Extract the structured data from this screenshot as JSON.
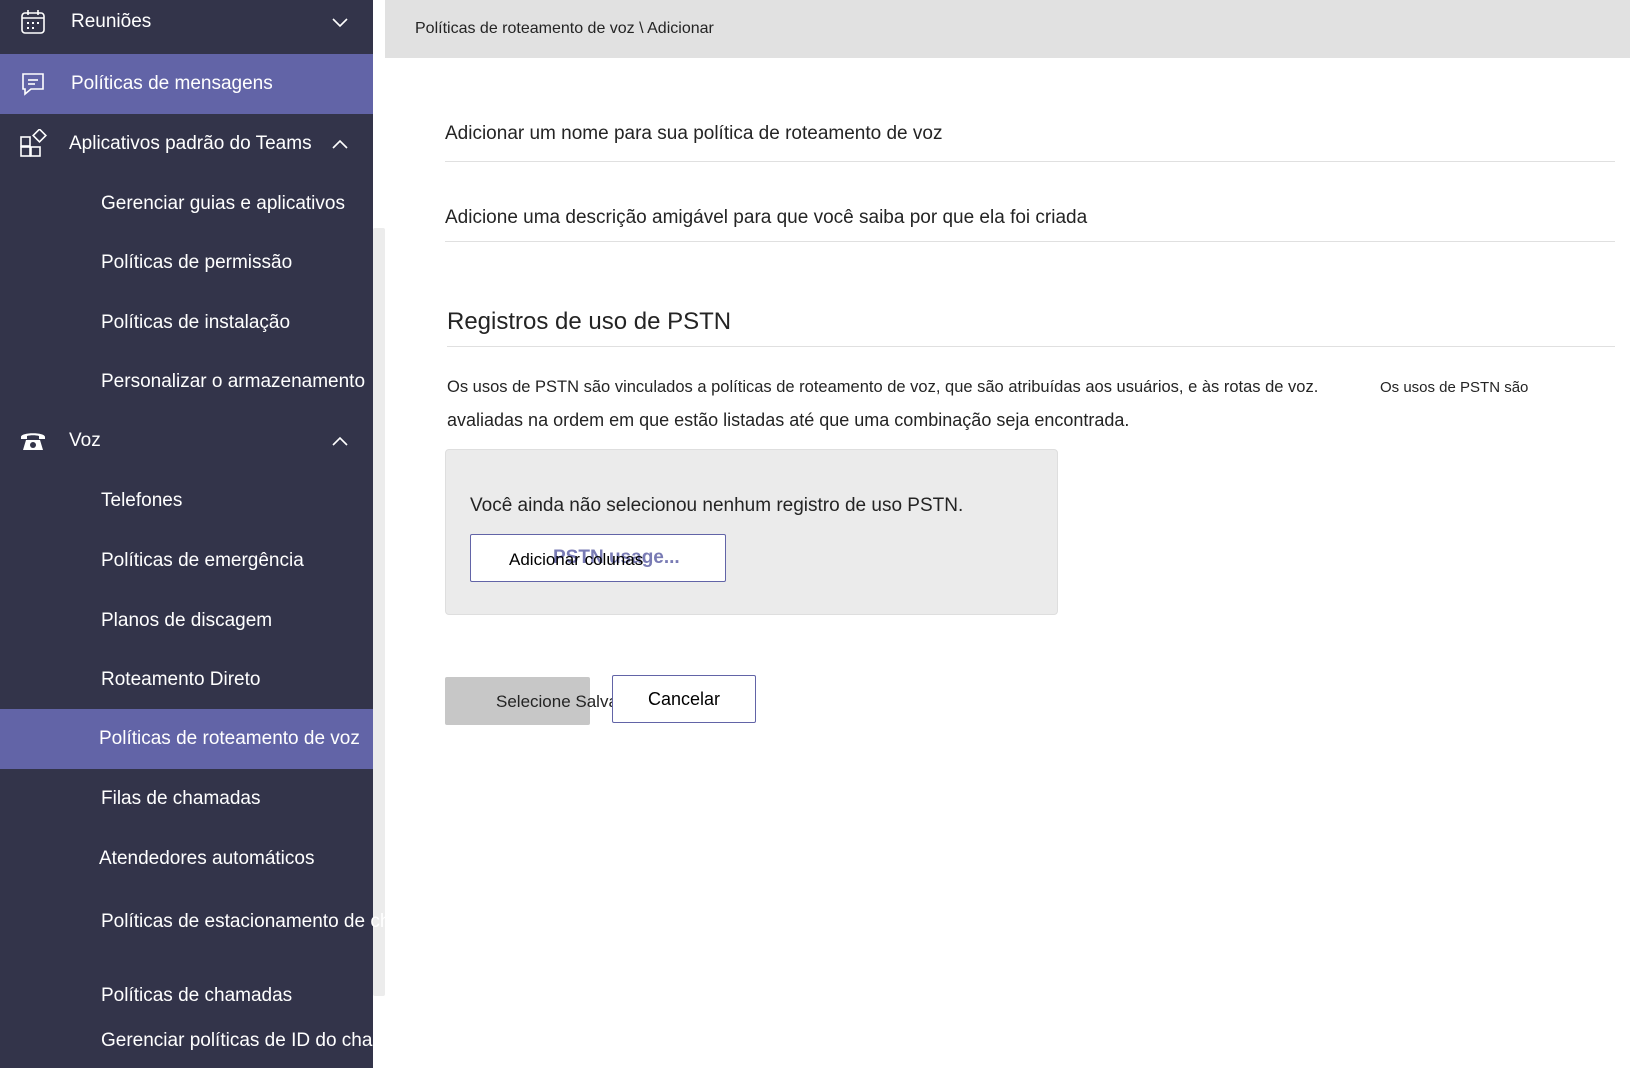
{
  "sidebar": {
    "items": [
      {
        "label": "Reuniões",
        "icon": "calendar-icon",
        "expanded": false
      },
      {
        "label": "Políticas de mensagens",
        "icon": "chat-icon",
        "active": true
      },
      {
        "label": "Aplicativos padrão do Teams",
        "icon": "apps-icon",
        "expanded": true
      },
      {
        "label": "Gerenciar guias e aplicativos"
      },
      {
        "label": "Políticas de permissão"
      },
      {
        "label": "Políticas de instalação"
      },
      {
        "label": "Personalizar o armazenamento"
      },
      {
        "label": "Voz",
        "icon": "phone-icon",
        "expanded": true
      },
      {
        "label": "Telefones"
      },
      {
        "label": "Políticas de emergência"
      },
      {
        "label": "Planos de discagem"
      },
      {
        "label": "Roteamento Direto"
      },
      {
        "label": "Políticas de roteamento de voz",
        "active": true
      },
      {
        "label": "Filas de chamadas"
      },
      {
        "label": "Atendedores automáticos"
      },
      {
        "label": "Políticas de estacionamento de chamada"
      },
      {
        "label": "Políticas de chamadas"
      },
      {
        "label": "Gerenciar políticas de ID do chamador"
      }
    ]
  },
  "header": {
    "breadcrumb": "Políticas de roteamento de voz \\ Adicionar"
  },
  "form": {
    "name_field": "Adicionar um nome para sua política de roteamento de voz",
    "description_field": "Adicione uma descrição amigável para que você saiba por que ela foi criada"
  },
  "pstn": {
    "title": "Registros de uso de PSTN",
    "description_line1": "Os usos de PSTN são vinculados a políticas de roteamento de voz, que são atribuídas aos usuários, e às rotas de voz.",
    "description_extra": "Os usos de PSTN são",
    "description_line2": "avaliadas na ordem em que estão listadas até que uma combinação seja encontrada.",
    "empty_message": "Você ainda não selecionou nenhum registro de uso PSTN.",
    "add_button_ghost": "PSTN usage...",
    "add_button_label": "Adicionar colunas"
  },
  "actions": {
    "save_label": "Selecione Salvar.",
    "cancel_label": "Cancelar"
  },
  "colors": {
    "sidebar_bg": "#33344a",
    "accent": "#6264a7",
    "header_bg": "#e1e1e1"
  }
}
